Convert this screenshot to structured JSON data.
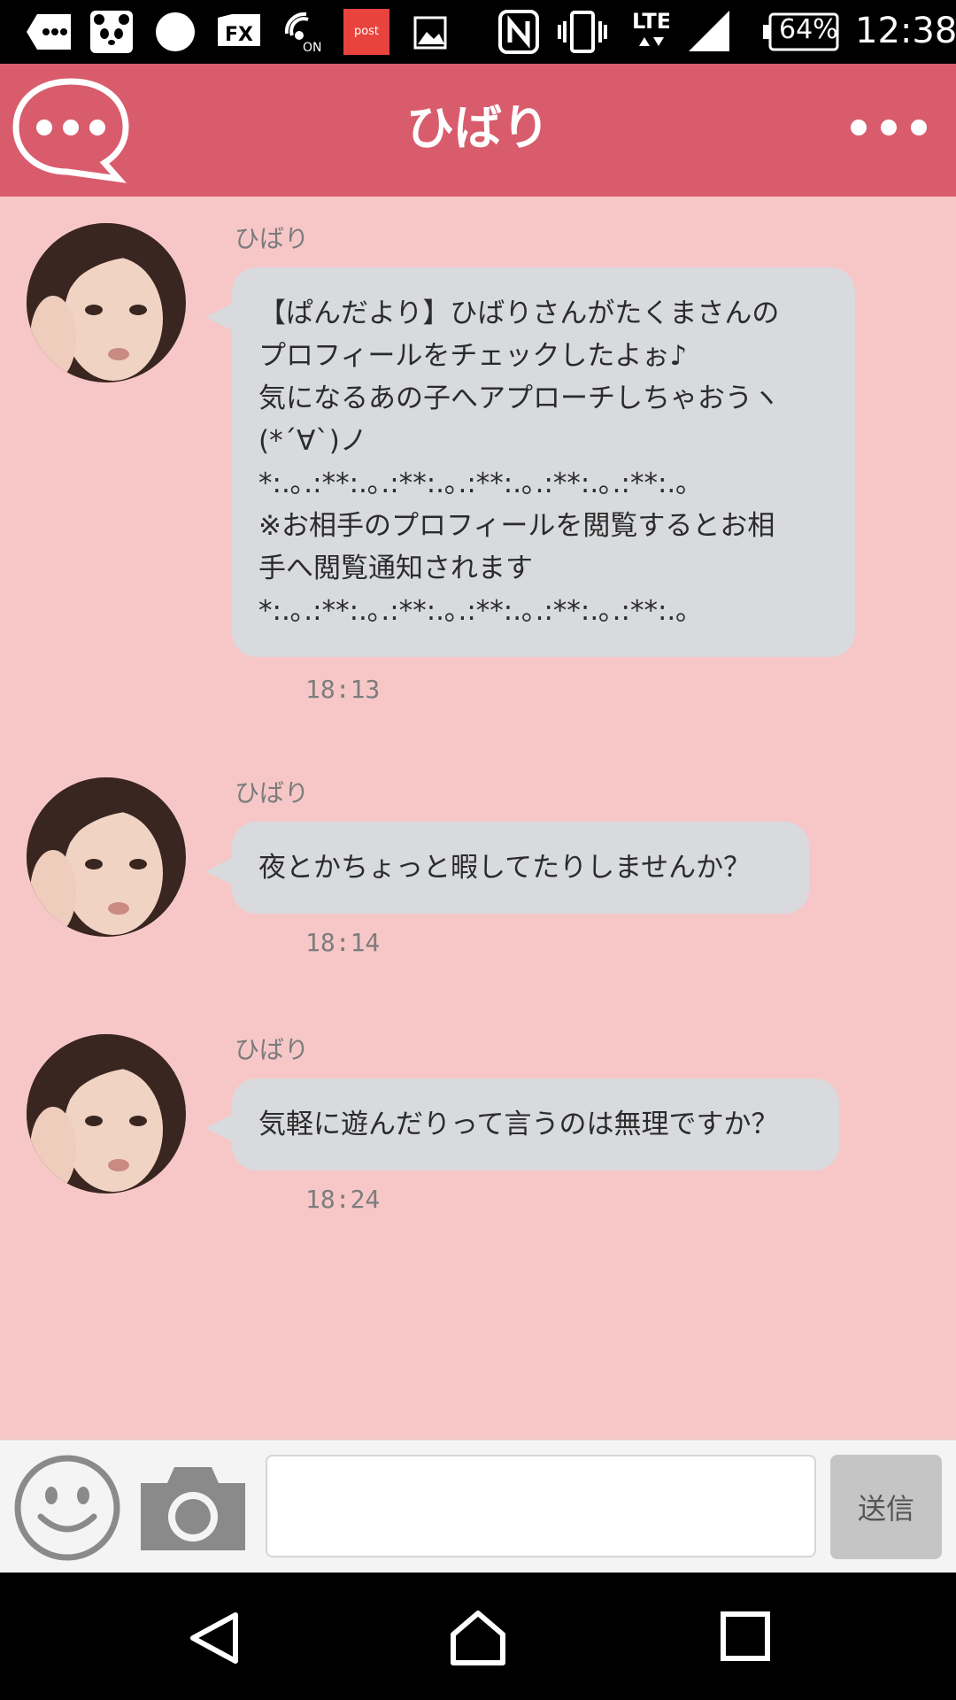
{
  "status_bar": {
    "battery": "64%",
    "time": "12:38",
    "network": "LTE",
    "app_badge_postme": "post me",
    "icons": [
      "message-icon",
      "panda-icon",
      "circle-icon",
      "fx-icon",
      "wifi-calling-icon",
      "postme-icon",
      "image-icon",
      "nfc-icon",
      "vibrate-icon",
      "lte-icon",
      "signal-icon",
      "battery-icon"
    ]
  },
  "header": {
    "title": "ひばり",
    "logo_icon": "chat-bubble-logo-icon",
    "menu_icon": "more-dots-icon"
  },
  "messages": [
    {
      "sender": "ひばり",
      "lines": [
        "【ぱんだより】ひばりさんがたくまさんの",
        "プロフィールをチェックしたよぉ♪",
        "気になるあの子へアプローチしちゃおうヽ",
        "(*´∀`)ノ",
        "*:.｡.:**:.｡.:**:.｡.:**:.｡.:**:.｡.:**:.｡",
        "※お相手のプロフィールを閲覧するとお相",
        "手へ閲覧通知されます",
        "*:.｡.:**:.｡.:**:.｡.:**:.｡.:**:.｡.:**:.｡"
      ],
      "time": "18:13"
    },
    {
      "sender": "ひばり",
      "lines": [
        "夜とかちょっと暇してたりしませんか？"
      ],
      "time": "18:14"
    },
    {
      "sender": "ひばり",
      "lines": [
        "気軽に遊んだりって言うのは無理ですか？"
      ],
      "time": "18:24"
    }
  ],
  "input_bar": {
    "text_value": "",
    "send_label": "送信",
    "emoji_icon": "smiley-icon",
    "camera_icon": "camera-icon"
  },
  "nav_bar": {
    "icons": [
      "back-icon",
      "home-icon",
      "recents-icon"
    ]
  },
  "colors": {
    "header": "#d95c6d",
    "background": "#f7c7c8",
    "bubble": "#d8dadd",
    "send_button": "#c5c5c5"
  }
}
